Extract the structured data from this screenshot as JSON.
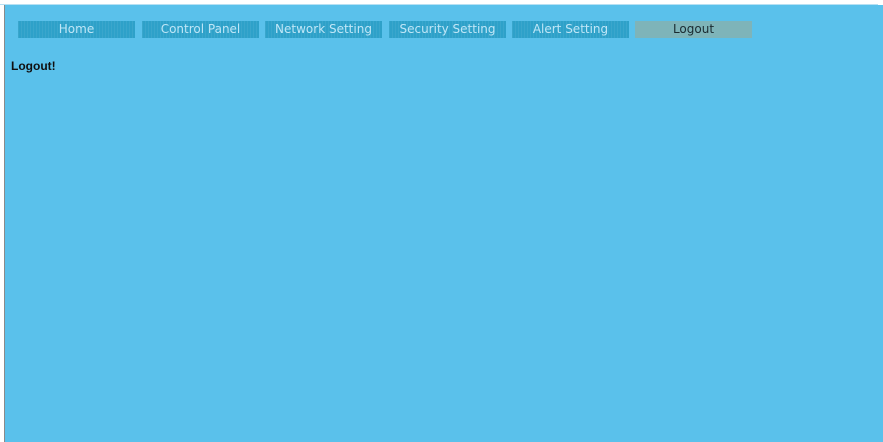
{
  "nav": {
    "tabs": [
      {
        "label": "Home",
        "active": false
      },
      {
        "label": "Control Panel",
        "active": false
      },
      {
        "label": "Network Setting",
        "active": false
      },
      {
        "label": "Security Setting",
        "active": false
      },
      {
        "label": "Alert Setting",
        "active": false
      },
      {
        "label": "Logout",
        "active": true
      }
    ]
  },
  "main": {
    "message": "Logout!"
  },
  "colors": {
    "background": "#5ac1eb",
    "tab": "#2ea1c9",
    "tab_active": "#7eb4b9"
  }
}
